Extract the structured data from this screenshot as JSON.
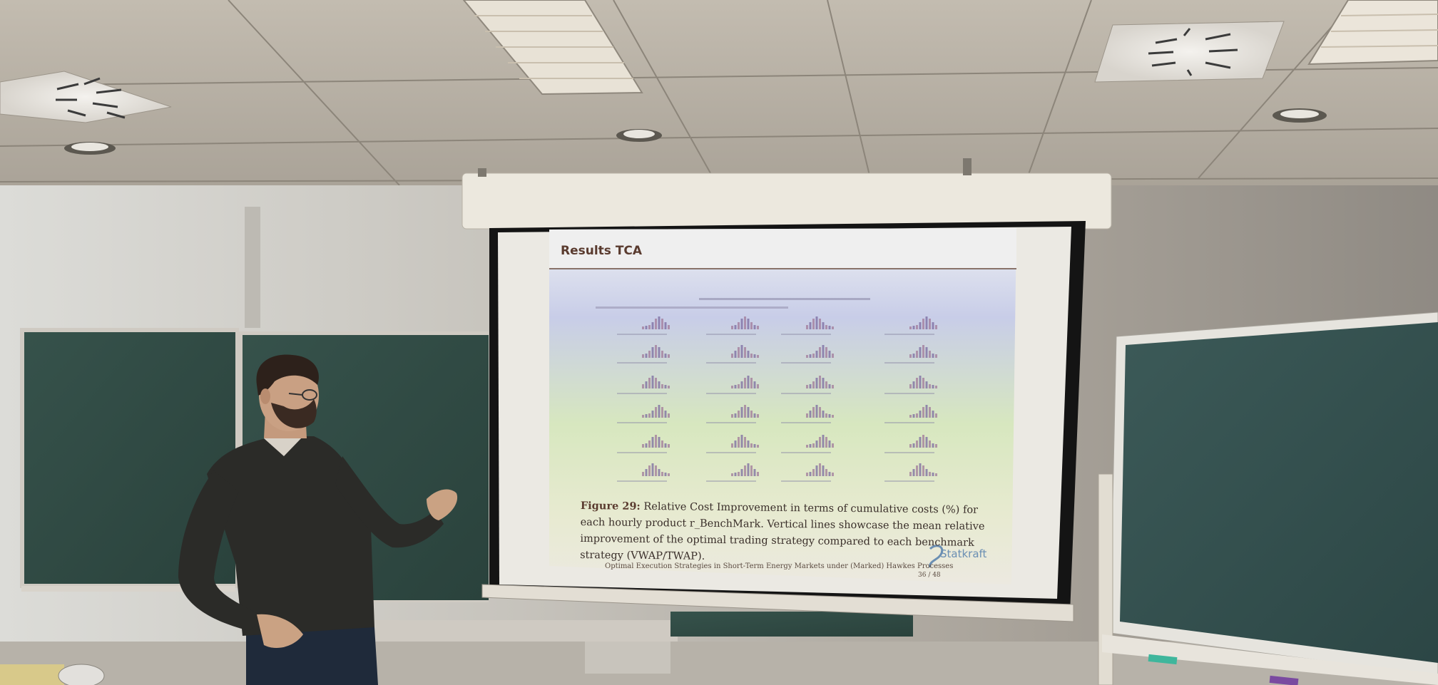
{
  "slide": {
    "title": "Results TCA",
    "caption_label": "Figure 29:",
    "caption_text": "Relative Cost Improvement in terms of cumulative costs (%) for each hourly product r_BenchMark. Vertical lines showcase the mean relative improvement of the optimal trading strategy compared to each benchmark strategy (VWAP/TWAP).",
    "footer": "Optimal Execution Strategies in Short-Term Energy Markets under (Marked) Hawkes Processes",
    "page": "36 / 48",
    "logo": "Statkraft"
  },
  "colors": {
    "ceiling": "#b9b2a6",
    "wall": "#a9a59e",
    "chalkboard": "#2f4a44",
    "screen_frame": "#141414",
    "slide_background": "#eeede8",
    "slide_title": "#5a3b2f",
    "sweater": "#2b2b28",
    "projection_tint_top": "#c9cfe6",
    "projection_tint_bottom": "#d9e6b8"
  },
  "icons": [
    "ceiling-vent-icon",
    "recessed-light-icon",
    "fluorescent-light-icon",
    "histogram-icon",
    "statkraft-logo-icon"
  ]
}
